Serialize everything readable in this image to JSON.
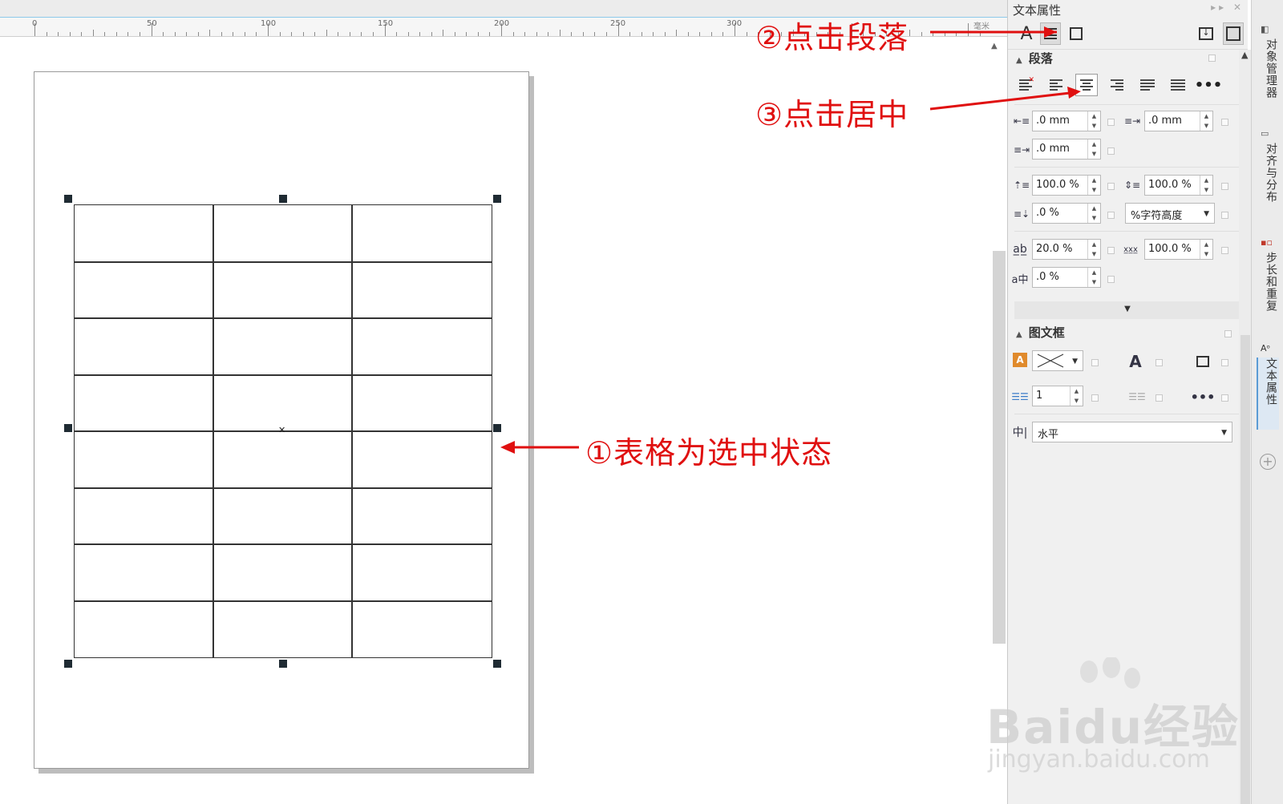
{
  "ruler": {
    "labels": [
      "0",
      "50",
      "100",
      "150",
      "200",
      "250",
      "300"
    ],
    "unit": "毫米"
  },
  "panel": {
    "title": "文本属性",
    "toolbar": {
      "character_icon": "character-icon",
      "paragraph_icon": "paragraph-icon",
      "frame_icon": "frame-icon"
    },
    "paragraph": {
      "heading": "段落",
      "align_buttons": [
        "no-align",
        "left",
        "center",
        "right",
        "full-justify",
        "force-justify",
        "more"
      ],
      "selected_align": "center",
      "left_indent": ".0 mm",
      "first_line_indent": ".0 mm",
      "right_indent": ".0 mm",
      "before_spacing": "100.0 %",
      "line_spacing": "100.0 %",
      "after_spacing": ".0 %",
      "spacing_unit": "%字符高度",
      "char_spacing": "20.0 %",
      "word_spacing": "100.0 %",
      "lang_spacing": ".0 %"
    },
    "frame": {
      "heading": "图文框",
      "columns": "1",
      "direction": "水平"
    }
  },
  "side_tabs": [
    "对象管理器",
    "对齐与分布",
    "步长和重复",
    "文本属性"
  ],
  "annotations": {
    "a1": "①表格为选中状态",
    "a2": "②点击段落",
    "a3": "③点击居中"
  },
  "watermark": {
    "logo": "Baidu经验",
    "url": "jingyan.baidu.com"
  },
  "colors": {
    "annotation": "#e01010",
    "panel_bg": "#f0f0f0",
    "ruler_accent": "#8cc9ea"
  }
}
